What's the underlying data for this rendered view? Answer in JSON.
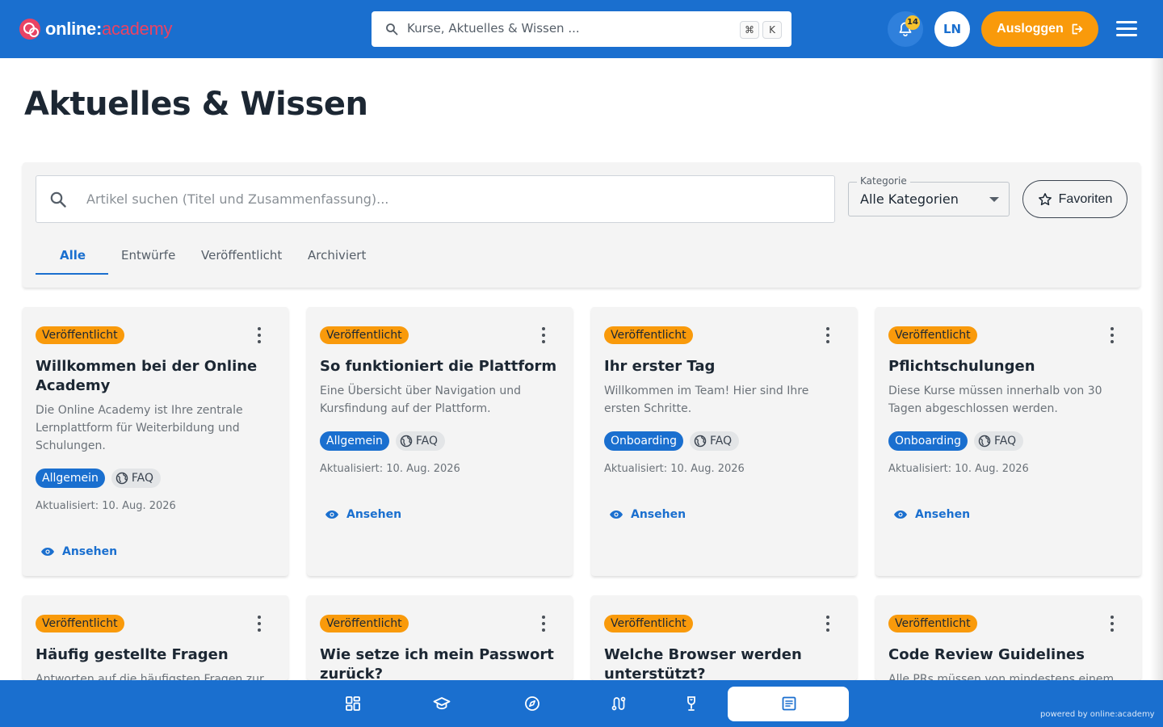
{
  "header": {
    "logo": {
      "brand": "online:",
      "accent": "academy"
    },
    "search": {
      "placeholder": "Kurse, Aktuelles & Wissen ...",
      "shortcut_mod": "⌘",
      "shortcut_key": "K"
    },
    "notifications": {
      "count": "14"
    },
    "avatar_initials": "LN",
    "logout_label": "Ausloggen"
  },
  "page": {
    "title": "Aktuelles & Wissen"
  },
  "filters": {
    "search_placeholder": "Artikel suchen (Titel und Zusammenfassung)...",
    "category": {
      "label": "Kategorie",
      "value": "Alle Kategorien"
    },
    "favorites_label": "Favoriten",
    "tabs": [
      {
        "label": "Alle",
        "active": true
      },
      {
        "label": "Entwürfe",
        "active": false
      },
      {
        "label": "Veröffentlicht",
        "active": false
      },
      {
        "label": "Archiviert",
        "active": false
      }
    ]
  },
  "cards": [
    {
      "status": "Veröffentlicht",
      "title": "Willkommen bei der Online Academy",
      "summary": "Die Online Academy ist Ihre zentrale Lernplattform für Weiterbildung und Schulungen.",
      "category": "Allgemein",
      "type": "FAQ",
      "updated": "Aktualisiert: 10. Aug. 2026",
      "action": "Ansehen"
    },
    {
      "status": "Veröffentlicht",
      "title": "So funktioniert die Plattform",
      "summary": "Eine Übersicht über Navigation und Kursfindung auf der Plattform.",
      "category": "Allgemein",
      "type": "FAQ",
      "updated": "Aktualisiert: 10. Aug. 2026",
      "action": "Ansehen"
    },
    {
      "status": "Veröffentlicht",
      "title": "Ihr erster Tag",
      "summary": "Willkommen im Team! Hier sind Ihre ersten Schritte.",
      "category": "Onboarding",
      "type": "FAQ",
      "updated": "Aktualisiert: 10. Aug. 2026",
      "action": "Ansehen"
    },
    {
      "status": "Veröffentlicht",
      "title": "Pflichtschulungen",
      "summary": "Diese Kurse müssen innerhalb von 30 Tagen abgeschlossen werden.",
      "category": "Onboarding",
      "type": "FAQ",
      "updated": "Aktualisiert: 10. Aug. 2026",
      "action": "Ansehen"
    },
    {
      "status": "Veröffentlicht",
      "title": "Häufig gestellte Fragen",
      "summary": "Antworten auf die häufigsten Fragen zur"
    },
    {
      "status": "Veröffentlicht",
      "title": "Wie setze ich mein Passwort zurück?"
    },
    {
      "status": "Veröffentlicht",
      "title": "Welche Browser werden unterstützt?"
    },
    {
      "status": "Veröffentlicht",
      "title": "Code Review Guidelines",
      "summary": "Alle PRs müssen von mindestens einem"
    }
  ],
  "bottom_nav": {
    "items": [
      "dashboard-icon",
      "courses-icon",
      "explore-icon",
      "learning-paths-icon",
      "achievements-icon",
      "articles-icon"
    ],
    "active": "articles-icon"
  },
  "footer": {
    "powered_by": "powered by online:academy"
  },
  "colors": {
    "primary": "#1a6fcf",
    "accent_orange": "#f99a0b",
    "logo_red": "#e94364",
    "panel_bg": "#f4f4f4"
  }
}
